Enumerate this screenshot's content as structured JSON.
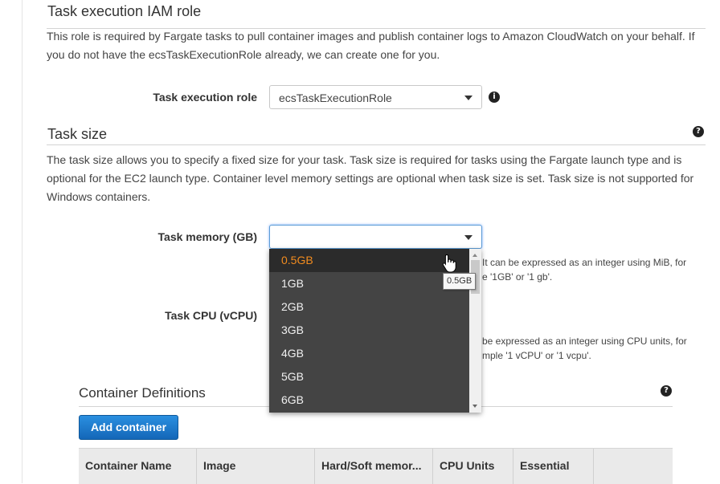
{
  "execution_role_section": {
    "title": "Task execution IAM role",
    "description": "This role is required by Fargate tasks to pull container images and publish container logs to Amazon CloudWatch on your behalf. If you do not have the ecsTaskExecutionRole already, we can create one for you.",
    "role_label": "Task execution role",
    "role_value": "ecsTaskExecutionRole"
  },
  "task_size_section": {
    "title": "Task size",
    "description": "The task size allows you to specify a fixed size for your task. Task size is required for tasks using the Fargate launch type and is optional for the EC2 launch type. Container level memory settings are optional when task size is set. Task size is not supported for Windows containers.",
    "memory_label": "Task memory (GB)",
    "memory_value": "",
    "memory_hint_line1": "It can be expressed as an integer using MiB, for",
    "memory_hint_line2": "e '1GB' or '1 gb'.",
    "cpu_label": "Task CPU (vCPU)",
    "cpu_hint_line1": "be expressed as an integer using CPU units, for",
    "cpu_hint_line2": "mple '1 vCPU' or '1 vcpu'."
  },
  "memory_dropdown": {
    "options": [
      "0.5GB",
      "1GB",
      "2GB",
      "3GB",
      "4GB",
      "5GB",
      "6GB"
    ],
    "highlighted": "0.5GB",
    "tooltip": "0.5GB"
  },
  "container_definitions": {
    "title": "Container Definitions",
    "add_button": "Add container",
    "columns": [
      "Container Name",
      "Image",
      "Hard/Soft memor...",
      "CPU Units",
      "Essential",
      ""
    ]
  },
  "colors": {
    "highlight_text": "#f28c1f",
    "dropdown_bg": "#444444",
    "primary_button": "#1a73c8"
  },
  "icons": {
    "info": "info-icon",
    "help": "help-icon",
    "caret": "chevron-down-icon",
    "cursor": "hand-pointer-icon"
  }
}
